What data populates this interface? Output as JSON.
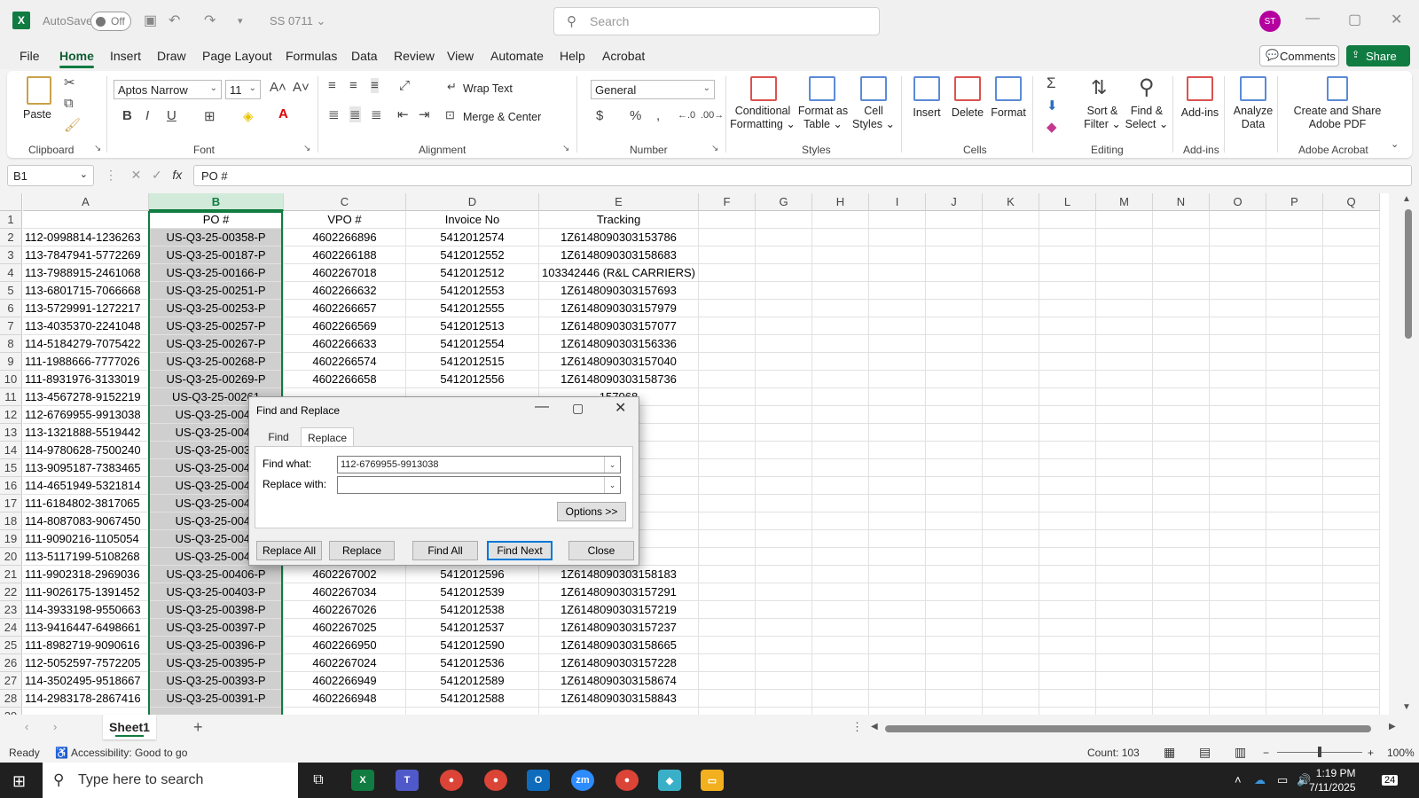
{
  "title_bar": {
    "app_logo": "X",
    "autosave_label": "AutoSave",
    "autosave_state": "Off",
    "document_name": "SS 0711 ⌄",
    "search_placeholder": "Search",
    "user_initials": "ST"
  },
  "menu": {
    "items": [
      "File",
      "Home",
      "Insert",
      "Draw",
      "Page Layout",
      "Formulas",
      "Data",
      "Review",
      "View",
      "Automate",
      "Help",
      "Acrobat"
    ],
    "active": "Home",
    "comments_label": "Comments",
    "share_label": "Share"
  },
  "ribbon": {
    "groups": [
      "Clipboard",
      "Font",
      "Alignment",
      "Number",
      "Styles",
      "Cells",
      "Editing",
      "Add-ins",
      "Adobe Acrobat"
    ],
    "paste_label": "Paste",
    "font_name": "Aptos Narrow",
    "font_size": "11",
    "wrap_text_label": "Wrap Text",
    "merge_center_label": "Merge & Center",
    "number_format": "General",
    "conditional_formatting": [
      "Conditional",
      "Formatting ⌄"
    ],
    "format_as_table": [
      "Format as",
      "Table ⌄"
    ],
    "cell_styles": [
      "Cell",
      "Styles ⌄"
    ],
    "insert_label": "Insert",
    "delete_label": "Delete",
    "format_label": "Format",
    "sort_filter": [
      "Sort &",
      "Filter ⌄"
    ],
    "find_select": [
      "Find &",
      "Select ⌄"
    ],
    "addins_label": "Add-ins",
    "analyze_data": [
      "Analyze",
      "Data"
    ],
    "create_share_pdf": [
      "Create and Share",
      "Adobe PDF"
    ],
    "accent_color": "#107c41"
  },
  "formula_bar": {
    "name_box": "B1",
    "fx": "fx",
    "content": "PO #"
  },
  "grid": {
    "columns": [
      "A",
      "B",
      "C",
      "D",
      "E",
      "F",
      "G",
      "H",
      "I",
      "J",
      "K",
      "L",
      "M",
      "N",
      "O",
      "P",
      "Q"
    ],
    "selected_column": "B",
    "headers": [
      "",
      "PO #",
      "VPO #",
      "Invoice No",
      "Tracking"
    ],
    "rows": [
      [
        "112-0998814-1236263",
        "US-Q3-25-00358-P",
        "4602266896",
        "5412012574",
        "1Z6148090303153786"
      ],
      [
        "113-7847941-5772269",
        "US-Q3-25-00187-P",
        "4602266188",
        "5412012552",
        "1Z6148090303158683"
      ],
      [
        "113-7988915-2461068",
        "US-Q3-25-00166-P",
        "4602267018",
        "5412012512",
        "103342446 (R&L CARRIERS)"
      ],
      [
        "113-6801715-7066668",
        "US-Q3-25-00251-P",
        "4602266632",
        "5412012553",
        "1Z6148090303157693"
      ],
      [
        "113-5729991-1272217",
        "US-Q3-25-00253-P",
        "4602266657",
        "5412012555",
        "1Z6148090303157979"
      ],
      [
        "113-4035370-2241048",
        "US-Q3-25-00257-P",
        "4602266569",
        "5412012513",
        "1Z6148090303157077"
      ],
      [
        "114-5184279-7075422",
        "US-Q3-25-00267-P",
        "4602266633",
        "5412012554",
        "1Z6148090303156336"
      ],
      [
        "111-1988666-7777026",
        "US-Q3-25-00268-P",
        "4602266574",
        "5412012515",
        "1Z6148090303157040"
      ],
      [
        "111-8931976-3133019",
        "US-Q3-25-00269-P",
        "4602266658",
        "5412012556",
        "1Z6148090303158736"
      ],
      [
        "113-4567278-9152219",
        "US-Q3-25-00261",
        "",
        "",
        "157068"
      ],
      [
        "112-6769955-9913038",
        "US-Q3-25-0048",
        "",
        "",
        "158861"
      ],
      [
        "113-1321888-5519442",
        "US-Q3-25-0042",
        "",
        "",
        "158423"
      ],
      [
        "114-9780628-7500240",
        "US-Q3-25-0036",
        "",
        "",
        "156658"
      ],
      [
        "113-9095187-7383465",
        "US-Q3-25-0042",
        "",
        "",
        "158503"
      ],
      [
        "114-4651949-5321814",
        "US-Q3-25-0041",
        "",
        "",
        "157326"
      ],
      [
        "111-6184802-3817065",
        "US-Q3-25-0041",
        "",
        "",
        "157335"
      ],
      [
        "114-8087083-9067450",
        "US-Q3-25-0041",
        "",
        "",
        "158530"
      ],
      [
        "111-9090216-1105054",
        "US-Q3-25-0041",
        "",
        "",
        "157808"
      ],
      [
        "113-5117199-5108268",
        "US-Q3-25-0040",
        "",
        "",
        "157317"
      ],
      [
        "111-9902318-2969036",
        "US-Q3-25-00406-P",
        "4602267002",
        "5412012596",
        "1Z6148090303158183"
      ],
      [
        "111-9026175-1391452",
        "US-Q3-25-00403-P",
        "4602267034",
        "5412012539",
        "1Z6148090303157291"
      ],
      [
        "114-3933198-9550663",
        "US-Q3-25-00398-P",
        "4602267026",
        "5412012538",
        "1Z6148090303157219"
      ],
      [
        "113-9416447-6498661",
        "US-Q3-25-00397-P",
        "4602267025",
        "5412012537",
        "1Z6148090303157237"
      ],
      [
        "111-8982719-9090616",
        "US-Q3-25-00396-P",
        "4602266950",
        "5412012590",
        "1Z6148090303158665"
      ],
      [
        "112-5052597-7572205",
        "US-Q3-25-00395-P",
        "4602267024",
        "5412012536",
        "1Z6148090303157228"
      ],
      [
        "114-3502495-9518667",
        "US-Q3-25-00393-P",
        "4602266949",
        "5412012589",
        "1Z6148090303158674"
      ],
      [
        "114-2983178-2867416",
        "US-Q3-25-00391-P",
        "4602266948",
        "5412012588",
        "1Z6148090303158843"
      ]
    ]
  },
  "sheet_tabs": {
    "active": "Sheet1",
    "add": "+"
  },
  "status_bar": {
    "ready": "Ready",
    "accessibility": "Accessibility: Good to go",
    "count": "Count: 103",
    "zoom": "100%"
  },
  "dialog": {
    "title": "Find and Replace",
    "tabs": [
      "Find",
      "Replace"
    ],
    "active_tab": "Replace",
    "find_what_label": "Find what:",
    "find_what_value": "112-6769955-9913038",
    "replace_with_label": "Replace with:",
    "replace_with_value": "",
    "options_label": "Options >>",
    "buttons": [
      "Replace All",
      "Replace",
      "Find All",
      "Find Next",
      "Close"
    ]
  },
  "taskbar": {
    "search_placeholder": "Type here to search",
    "time": "1:19 PM",
    "date": "7/11/2025",
    "notifications": "24"
  }
}
